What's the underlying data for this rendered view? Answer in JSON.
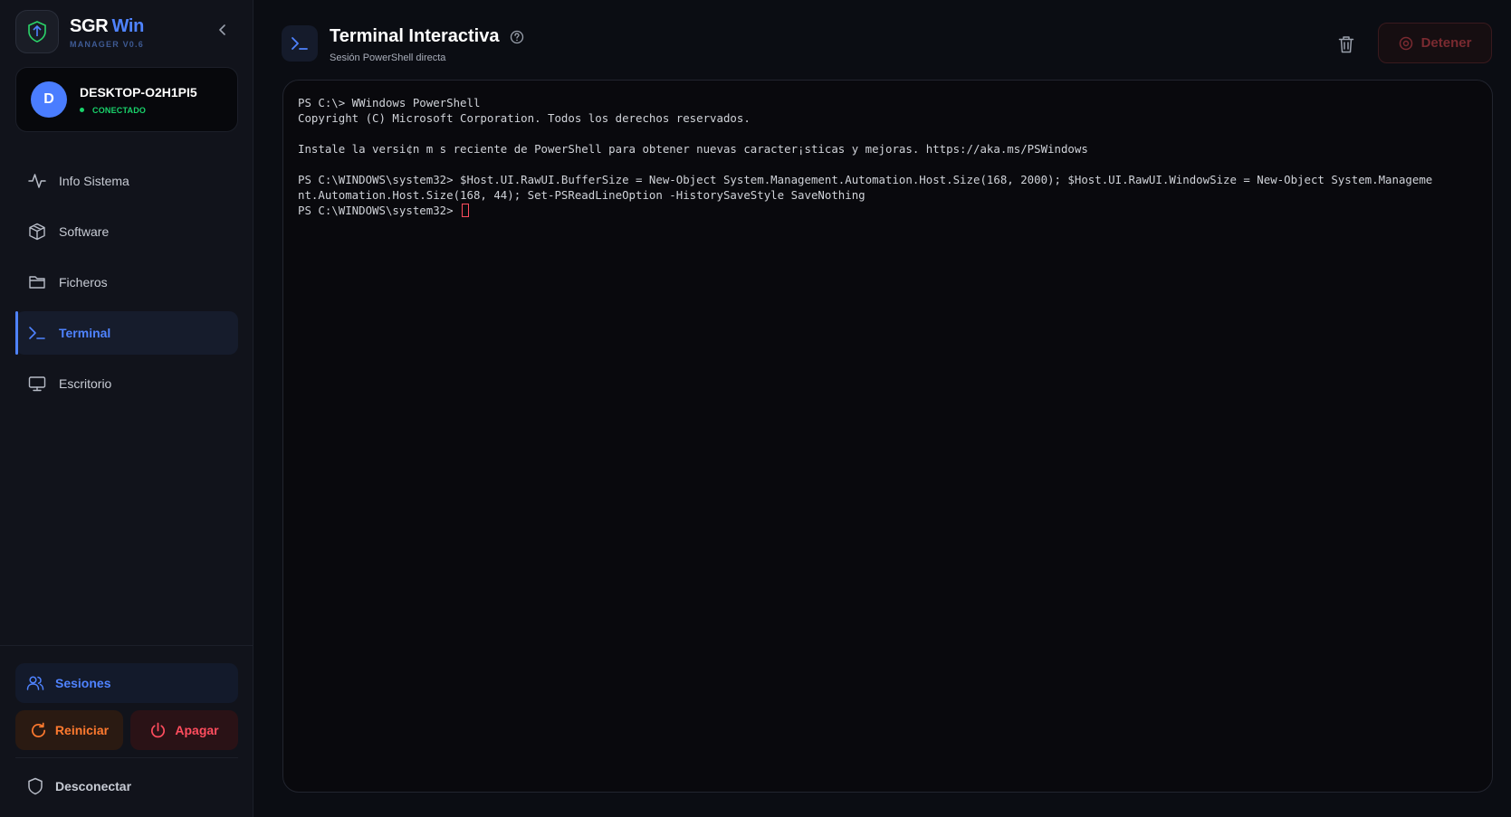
{
  "brand": {
    "title": "SGR",
    "title_accent": "Win",
    "subtitle": "MANAGER V0.6"
  },
  "device": {
    "avatar_letter": "D",
    "name": "DESKTOP-O2H1PI5",
    "status": "CONECTADO"
  },
  "nav": {
    "items": [
      {
        "label": "Info Sistema",
        "icon": "activity-icon"
      },
      {
        "label": "Software",
        "icon": "package-icon"
      },
      {
        "label": "Ficheros",
        "icon": "folder-icon"
      },
      {
        "label": "Terminal",
        "icon": "terminal-icon",
        "active": true
      },
      {
        "label": "Escritorio",
        "icon": "monitor-icon"
      }
    ]
  },
  "footer": {
    "sessions_label": "Sesiones",
    "restart_label": "Reiniciar",
    "shutdown_label": "Apagar",
    "disconnect_label": "Desconectar"
  },
  "header": {
    "title": "Terminal Interactiva",
    "subtitle": "Sesión PowerShell directa",
    "stop_label": "Detener"
  },
  "terminal": {
    "lines": [
      "PS C:\\> WWindows PowerShell",
      "Copyright (C) Microsoft Corporation. Todos los derechos reservados.",
      "",
      "Instale la versi¢n m s reciente de PowerShell para obtener nuevas caracter¡sticas y mejoras. https://aka.ms/PSWindows",
      "",
      "PS C:\\WINDOWS\\system32> $Host.UI.RawUI.BufferSize = New-Object System.Management.Automation.Host.Size(168, 2000); $Host.UI.RawUI.WindowSize = New-Object System.Manageme",
      "nt.Automation.Host.Size(168, 44); Set-PSReadLineOption -HistorySaveStyle SaveNothing"
    ],
    "prompt": "PS C:\\WINDOWS\\system32> "
  },
  "colors": {
    "accent": "#4f83ff",
    "success": "#19d36b",
    "warning": "#ff7a2f",
    "danger": "#ff4d5e"
  }
}
